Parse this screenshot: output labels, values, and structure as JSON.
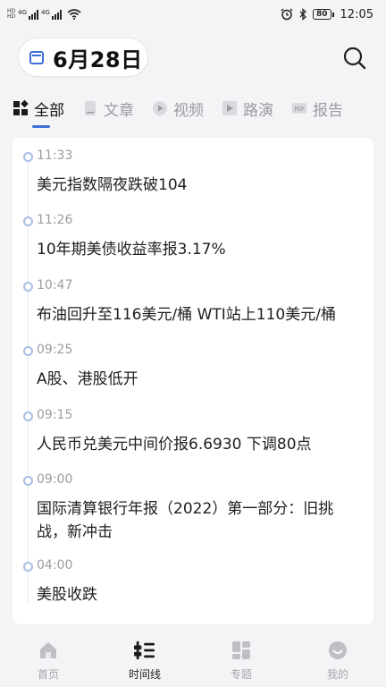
{
  "status_bar": {
    "sim1_label": "HD",
    "sim2_label": "HD",
    "net1": "4G",
    "net2": "4G",
    "battery": "80",
    "time": "12:05"
  },
  "header": {
    "date": "6月28日",
    "calendar_icon": "calendar-icon",
    "search_icon": "search-icon"
  },
  "tabs": [
    {
      "label": "全部",
      "icon": "grid-icon",
      "active": true
    },
    {
      "label": "文章",
      "icon": "document-icon",
      "active": false
    },
    {
      "label": "视频",
      "icon": "play-icon",
      "active": false
    },
    {
      "label": "路演",
      "icon": "roadshow-icon",
      "active": false
    },
    {
      "label": "报告",
      "icon": "pdf-icon",
      "active": false
    }
  ],
  "timeline": [
    {
      "time": "11:33",
      "title": "美元指数隔夜跌破104"
    },
    {
      "time": "11:26",
      "title": "10年期美债收益率报3.17%"
    },
    {
      "time": "10:47",
      "title": "布油回升至116美元/桶 WTI站上110美元/桶"
    },
    {
      "time": "09:25",
      "title": "A股、港股低开"
    },
    {
      "time": "09:15",
      "title": "人民币兑美元中间价报6.6930 下调80点"
    },
    {
      "time": "09:00",
      "title": "国际清算银行年报（2022）第一部分：旧挑战，新冲击"
    },
    {
      "time": "04:00",
      "title": "美股收跌"
    }
  ],
  "bottom_nav": [
    {
      "label": "首页",
      "icon": "home-icon",
      "active": false
    },
    {
      "label": "时间线",
      "icon": "timeline-icon",
      "active": true
    },
    {
      "label": "专题",
      "icon": "topics-icon",
      "active": false
    },
    {
      "label": "我的",
      "icon": "profile-icon",
      "active": false
    }
  ],
  "colors": {
    "accent": "#3b6fd8",
    "dot": "#a9bde6",
    "muted": "#9c9ca4",
    "background": "#f4f4f6"
  }
}
